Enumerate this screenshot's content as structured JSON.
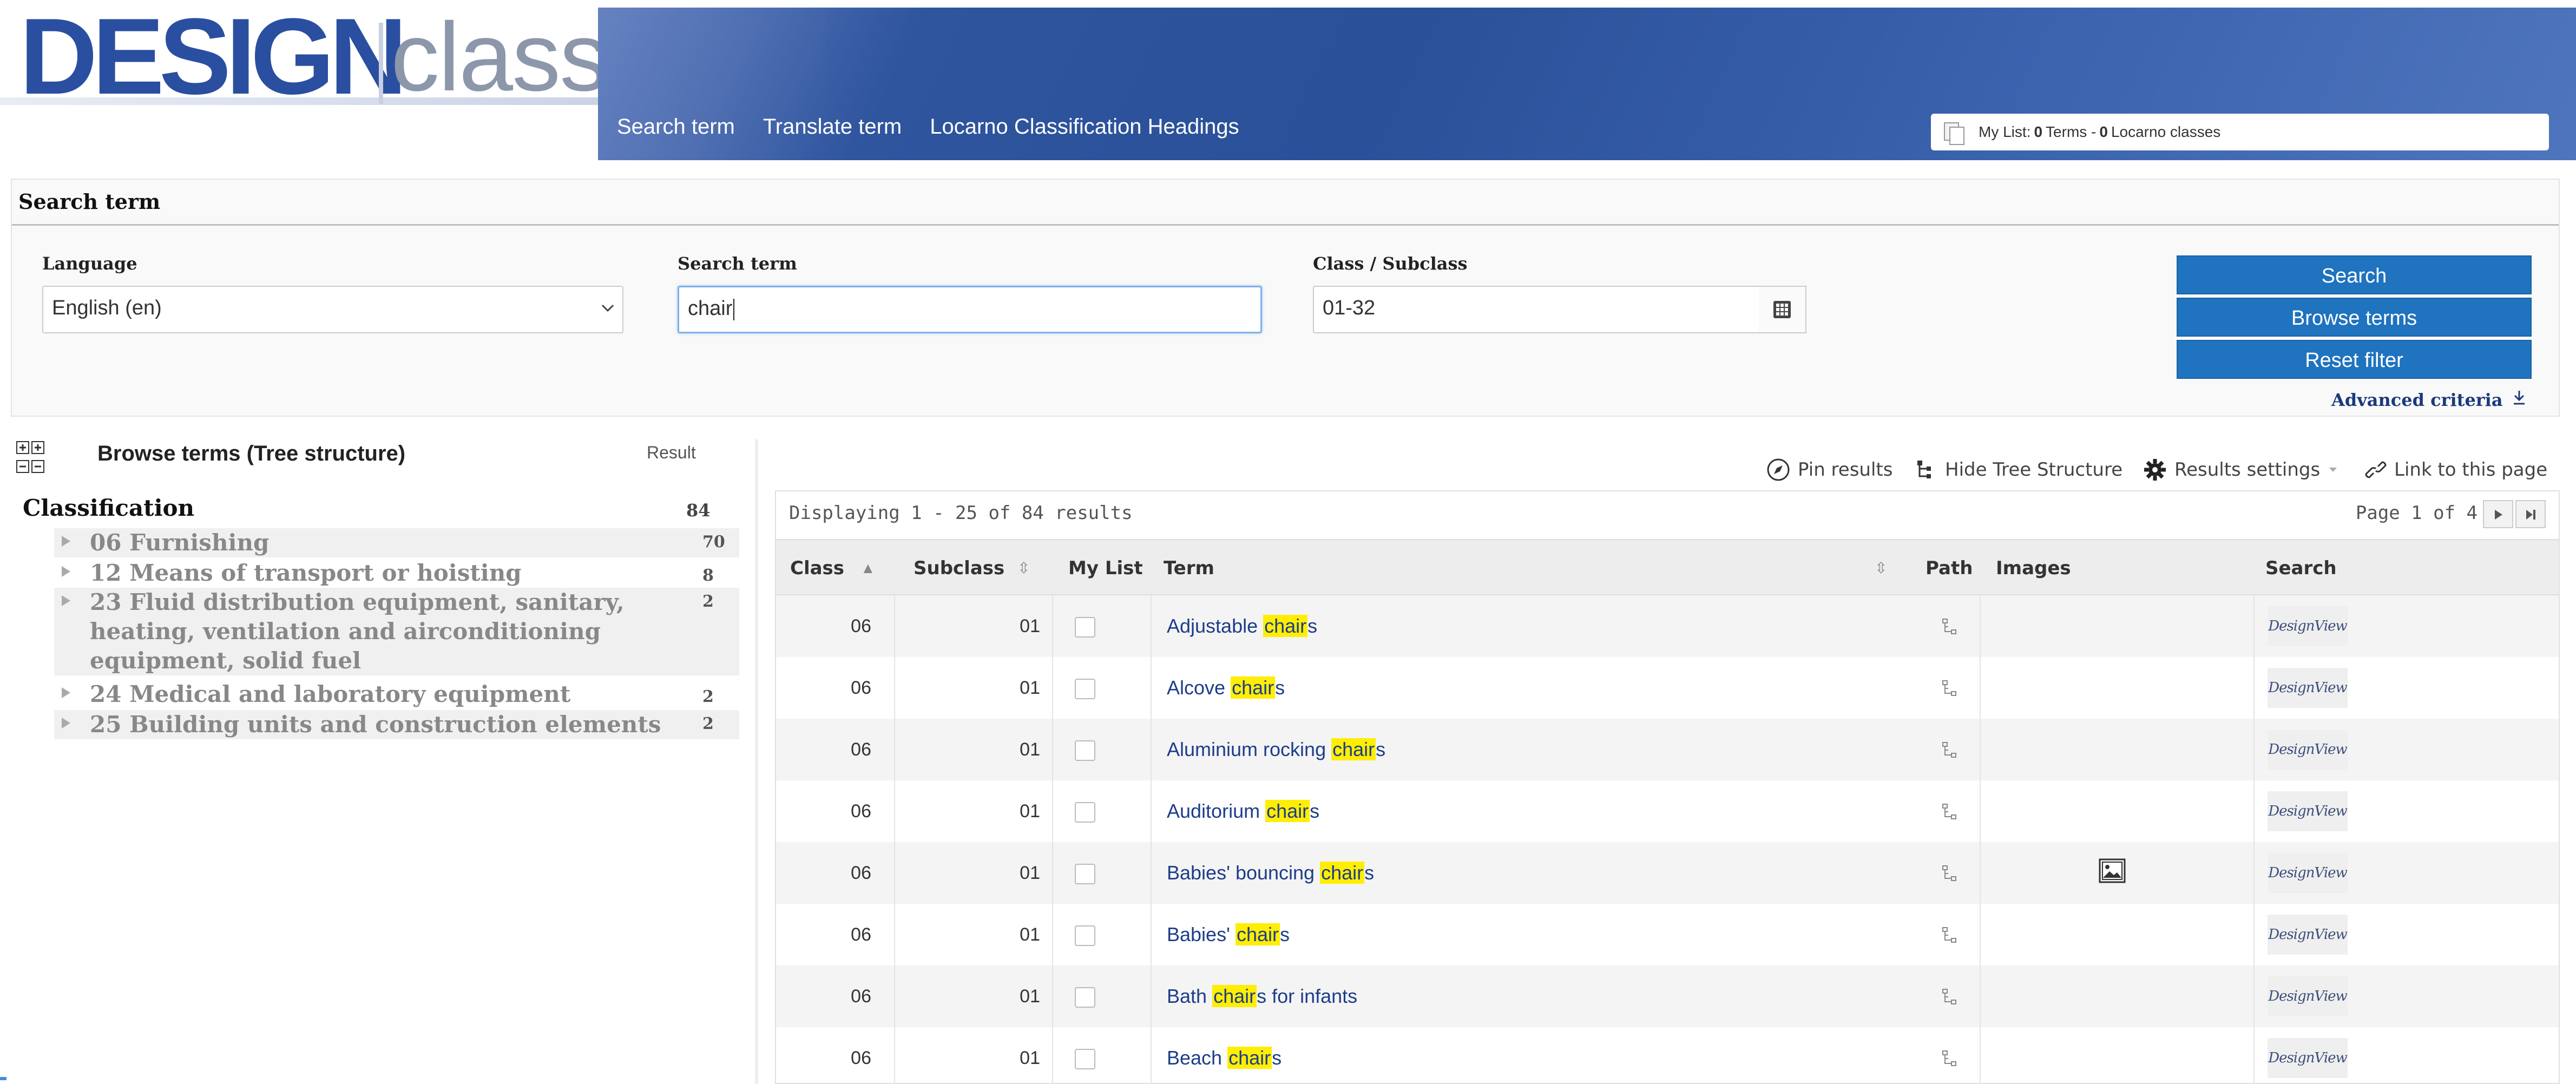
{
  "header": {
    "logo_design": "DESIGN",
    "logo_class": "class",
    "nav": [
      "Search term",
      "Translate term",
      "Locarno Classification Headings"
    ],
    "mylist": {
      "prefix": "My List:",
      "terms_count": "0",
      "terms_label": "Terms -",
      "classes_count": "0",
      "classes_label": "Locarno classes"
    }
  },
  "search": {
    "title": "Search term",
    "language_label": "Language",
    "language_value": "English (en)",
    "term_label": "Search term",
    "term_value": "chair",
    "class_label": "Class / Subclass",
    "class_value": "01-32",
    "buttons": {
      "search": "Search",
      "browse": "Browse terms",
      "reset": "Reset filter"
    },
    "advanced": "Advanced criteria"
  },
  "tree": {
    "title": "Browse terms (Tree structure)",
    "result_label": "Result",
    "root_label": "Classification",
    "root_count": "84",
    "items": [
      {
        "label": "06 Furnishing",
        "count": "70"
      },
      {
        "label": "12 Means of transport or hoisting",
        "count": "8"
      },
      {
        "label": "23 Fluid distribution equipment, sanitary, heating, ventilation and airconditioning equipment, solid fuel",
        "count": "2"
      },
      {
        "label": "24 Medical and laboratory equipment",
        "count": "2"
      },
      {
        "label": "25 Building units and construction elements",
        "count": "2"
      }
    ]
  },
  "toolbar": {
    "pin": "Pin results",
    "hide_tree": "Hide Tree Structure",
    "settings": "Results settings",
    "link": "Link to this page"
  },
  "results": {
    "displaying": "Displaying 1 - 25 of 84 results",
    "page": "Page 1 of 4",
    "columns": [
      "Class",
      "Subclass",
      "My List",
      "Term",
      "Path",
      "Images",
      "Search"
    ],
    "search_logo": "DesignView",
    "rows": [
      {
        "class": "06",
        "subclass": "01",
        "pre": "Adjustable ",
        "hl": "chair",
        "post": "s",
        "image": false
      },
      {
        "class": "06",
        "subclass": "01",
        "pre": "Alcove ",
        "hl": "chair",
        "post": "s",
        "image": false
      },
      {
        "class": "06",
        "subclass": "01",
        "pre": "Aluminium rocking ",
        "hl": "chair",
        "post": "s",
        "image": false
      },
      {
        "class": "06",
        "subclass": "01",
        "pre": "Auditorium ",
        "hl": "chair",
        "post": "s",
        "image": false
      },
      {
        "class": "06",
        "subclass": "01",
        "pre": "Babies' bouncing ",
        "hl": "chair",
        "post": "s",
        "image": true
      },
      {
        "class": "06",
        "subclass": "01",
        "pre": "Babies' ",
        "hl": "chair",
        "post": "s",
        "image": false
      },
      {
        "class": "06",
        "subclass": "01",
        "pre": "Bath ",
        "hl": "chair",
        "post": "s for infants",
        "image": false
      },
      {
        "class": "06",
        "subclass": "01",
        "pre": "Beach ",
        "hl": "chair",
        "post": "s",
        "image": false
      }
    ]
  },
  "colors": {
    "brand": "#2a4fa0",
    "button": "#1f73bf",
    "highlight": "#ffee00",
    "link": "#1d3d8a"
  }
}
